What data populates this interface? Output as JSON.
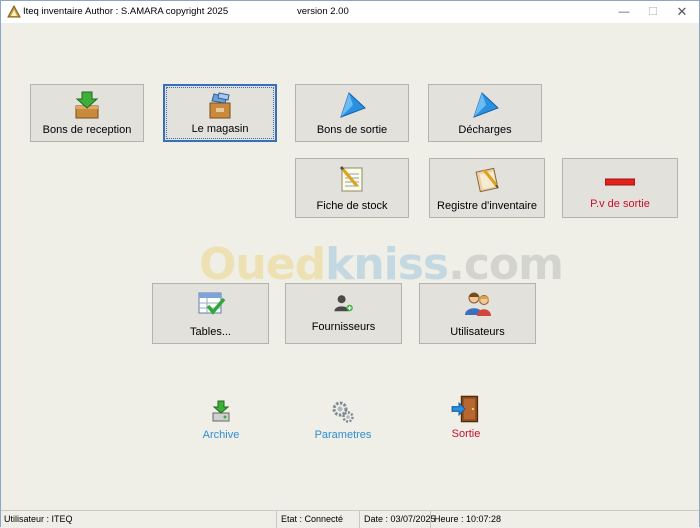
{
  "title": {
    "app": "Iteq inventaire",
    "author": "Author : S.AMARA   copyright 2025",
    "version": "version 2.00"
  },
  "tiles": {
    "bons_reception": "Bons de reception",
    "magasin": "Le magasin",
    "bons_sortie": "Bons de sortie",
    "decharges": "Décharges",
    "fiche_stock": "Fiche de stock",
    "registre": "Registre d'inventaire",
    "pv_sortie": "P.v de sortie",
    "tables": "Tables...",
    "fournisseurs": "Fournisseurs",
    "utilisateurs": "Utilisateurs"
  },
  "links": {
    "archive": "Archive",
    "parametres": "Parametres",
    "sortie": "Sortie"
  },
  "watermark": {
    "part1": "Oued",
    "part2": "kniss",
    "part3": ".com"
  },
  "status": {
    "user": "Utilisateur : ITEQ",
    "etat": "Etat : Connecté",
    "date": "Date : 03/07/2025",
    "heure": "Heure : 10:07:28"
  },
  "colors": {
    "link_blue": "#2e8fd6",
    "accent_red": "#c8102e",
    "selection": "#3b6fb4"
  },
  "icons": {
    "bons_reception": "download-box-icon",
    "magasin": "store-box-icon",
    "bons_sortie": "play-arrow-icon",
    "decharges": "play-arrow-icon",
    "fiche_stock": "notepad-pencil-icon",
    "registre": "register-pencil-icon",
    "pv_sortie": "minus-bar-icon",
    "tables": "table-check-icon",
    "fournisseurs": "supplier-user-icon",
    "utilisateurs": "users-icon",
    "archive": "archive-drive-icon",
    "parametres": "gears-icon",
    "sortie": "exit-door-icon"
  }
}
